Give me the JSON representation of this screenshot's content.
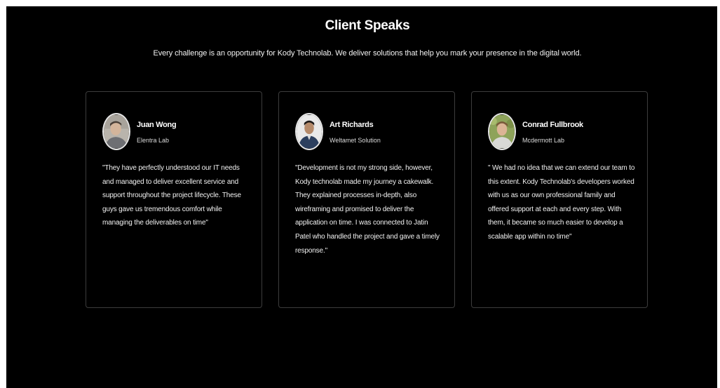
{
  "section": {
    "title": "Client Speaks",
    "subtitle": "Every challenge is an opportunity for Kody Technolab. We deliver solutions that help you mark your presence in the digital world."
  },
  "testimonials": [
    {
      "name": "Juan Wong",
      "company": "Elentra Lab",
      "quote": "\"They have perfectly understood our IT needs and managed to deliver excellent service and support throughout the project lifecycle. These guys gave us tremendous comfort while managing the deliverables on time\""
    },
    {
      "name": "Art Richards",
      "company": "Weltamet Solution",
      "quote": "\"Development is not my strong side, however, Kody technolab made my journey a cakewalk. They explained processes in-depth, also wireframing and promised to deliver the application on time. I was connected to Jatin Patel who handled the project and gave a timely response.\""
    },
    {
      "name": "Conrad Fullbrook",
      "company": "Mcdermott Lab",
      "quote": "\" We had no idea that we can extend our team to this extent. Kody Technolab's developers worked with us as our own professional family and offered support at each and every step. With them, it became so much easier to develop a scalable app within no time\""
    }
  ]
}
